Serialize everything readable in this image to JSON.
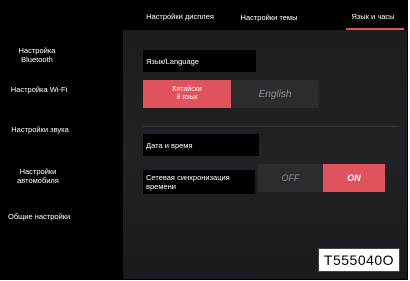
{
  "top_tabs": {
    "display": "Настройки дисплея",
    "theme": "Настройки темы",
    "language": "Язык и часы"
  },
  "sidebar": {
    "items": [
      {
        "label": "Настройка\nBluetooth"
      },
      {
        "label": "Настройка Wi-Fi"
      },
      {
        "label": "Настройки звука"
      },
      {
        "label": "Настройки\nавтомобиля"
      },
      {
        "label": "Общие настройки"
      }
    ]
  },
  "language": {
    "heading": "Язык/Language",
    "options": [
      {
        "label": "Китайски\nй язык",
        "selected": true
      },
      {
        "label": "English",
        "selected": false
      }
    ]
  },
  "datetime": {
    "heading": "Дата и время",
    "sync_label": "Сетевая синхронизация\nвремени",
    "off_label": "OFF",
    "on_label": "ON",
    "sync_state": "ON"
  },
  "stamp": "T555040O",
  "colors": {
    "accent": "#e0525c",
    "panel": "#1f1f22",
    "inactive_text": "#8e8e94"
  }
}
